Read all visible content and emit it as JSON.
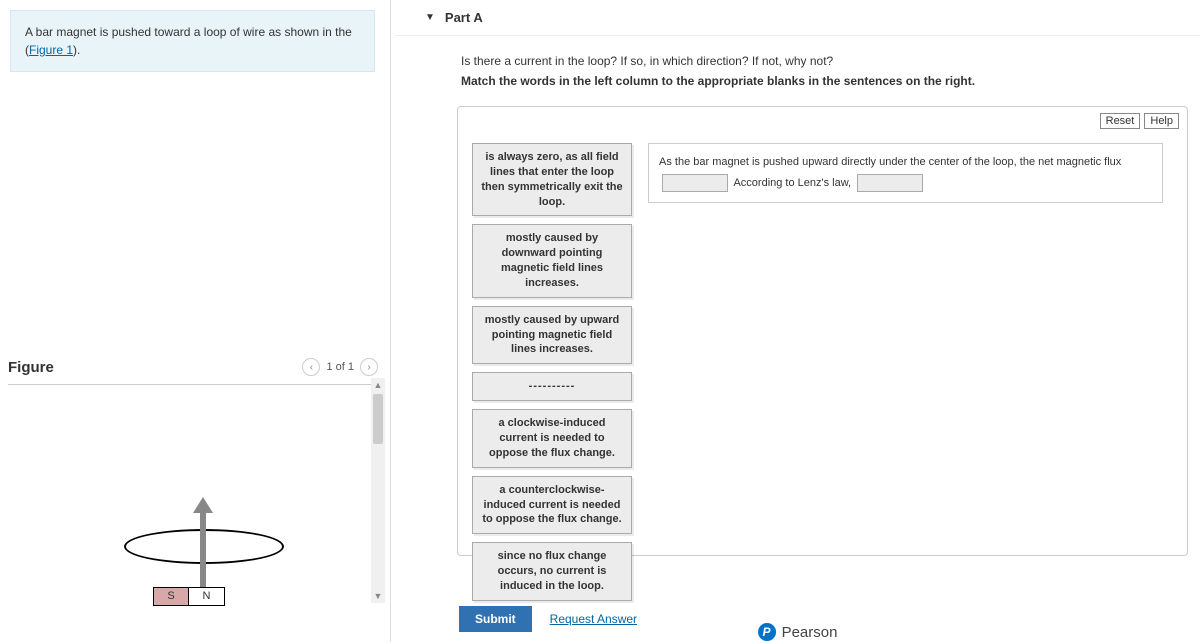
{
  "problem": {
    "text_prefix": "A bar magnet is pushed toward a loop of wire as shown in the (",
    "figure_link": "Figure 1",
    "text_suffix": ")."
  },
  "figure": {
    "title": "Figure",
    "pager": "1 of 1",
    "magnet_s": "S",
    "magnet_n": "N"
  },
  "part": {
    "label": "Part A",
    "question": "Is there a current in the loop? If so, in which direction? If not, why not?",
    "instruction": "Match the words in the left column to the appropriate blanks in the sentences on the right."
  },
  "tools": {
    "reset": "Reset",
    "help": "Help"
  },
  "words": [
    "is always zero, as all field lines that enter the loop then symmetrically exit the loop.",
    "mostly caused by downward pointing magnetic field lines increases.",
    "mostly caused by upward pointing magnetic field lines increases.",
    "----------",
    "a clockwise-induced current is needed to oppose the flux change.",
    "a counterclockwise-induced current is needed to oppose the flux change.",
    "since no flux change occurs, no current is induced in the loop."
  ],
  "sentence": {
    "seg1": "As the bar magnet is pushed upward directly under the center of the loop, the net magnetic flux",
    "seg2": "According to Lenz's law,"
  },
  "actions": {
    "submit": "Submit",
    "request": "Request Answer"
  },
  "brand": {
    "name": "Pearson",
    "badge": "P"
  }
}
